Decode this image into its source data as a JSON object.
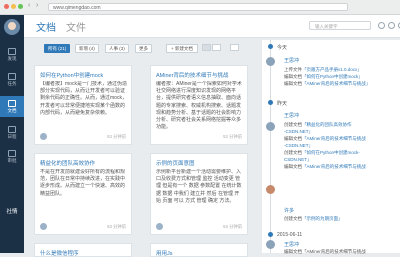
{
  "browser": {
    "url": "www.qimengdao.com"
  },
  "sidebar": {
    "items": [
      {
        "label": "发现",
        "active": false
      },
      {
        "label": "任务",
        "active": false
      },
      {
        "label": "文档",
        "active": true
      },
      {
        "label": "日程",
        "active": false
      },
      {
        "label": "审批",
        "active": false
      }
    ],
    "bottom_label": "社情"
  },
  "header": {
    "tab_docs": "文档",
    "tab_files": "文件",
    "search_placeholder": "输入关键字"
  },
  "filters": {
    "items": [
      "所有 (21)",
      "新增 (4)",
      "人事 (3)",
      "更多"
    ],
    "new_doc": "+ 新建文档"
  },
  "cards": [
    {
      "title": "如何在Python中创建mock",
      "body": "【编者按】mock是一门技术，通过伪造部分实现代码，从而让开发者可以验证剩余代码的正确性。从而，通过mock，开发者可以非常便捷地实现某个函数的内部代码，从而避免复杂依赖。",
      "foot": "53 分钟前"
    },
    {
      "title": "AMiner背后的技术细节与挑战",
      "body": "编者按：AMiner是一个探索如何对学术社交网络进行深度知识发现的网络平台，提供研究者语义信息抽取、面向话题的专家搜索、权威机构搜索、话题发现和趋势分析、基于话题的社会影响力分析、研究者社会关系网络挖掘等众多功能。",
      "foot": "53 分钟前"
    },
    {
      "title": "精益化的团队高效协作",
      "body": "不是在开发前就建设好所有的流程和规范，团队在日常中持续改进，在实践中逐步形成。从而建立一个快速、高效的精益团队。",
      "foot": "53 分钟前"
    },
    {
      "title": "示例的页面意图",
      "body": "示例新平台新建一个活动需要维护、入口及收费方式和管理 监控 活动变更 管理 但是有一个 数据 参数配置 在统计数据 数据 中我们 建立并 然后 在管理 开始 页面 可以 方式 管理 确定 方法。",
      "foot": "53 分钟前"
    },
    {
      "title": "什么是微信程序",
      "body": "",
      "foot": ""
    },
    {
      "title": "用用Js",
      "body": "",
      "foot": ""
    }
  ],
  "activity": {
    "today_label": "今天",
    "groups": [
      {
        "name": "王思冲",
        "lines": [
          {
            "verb": "上传文件",
            "link": "「页雁方产品手册v1.0.docx」"
          },
          {
            "verb": "编辑文档",
            "link": "「如何在Python中创建mock」"
          },
          {
            "verb": "编辑文档",
            "link": "「AMiner背后的技术细节与挑战」"
          }
        ]
      },
      {
        "name": "王思冲",
        "sub": "昨天",
        "lines": [
          {
            "verb": "创建文档",
            "link": "「精益化的团队高效协作"
          },
          {
            "verb": "",
            "link": "-CSDN.NET」"
          },
          {
            "verb": "编辑文档",
            "link": "「AMiner背后的技术细节与挑战"
          },
          {
            "verb": "",
            "link": "-CSDN.NET」"
          },
          {
            "verb": "创建文档",
            "link": "「如何在Python中创建mock-"
          },
          {
            "verb": "",
            "link": "CSDN.NET」"
          },
          {
            "verb": "编辑文档",
            "link": "「AMiner背后的技术细节与挑战"
          }
        ]
      },
      {
        "name": "许多",
        "lines": [
          {
            "verb": "创建文档",
            "link": "「示例的为期页面」"
          }
        ]
      }
    ],
    "date_label": "2015-06-11",
    "last_name": "王思冲",
    "last_line": "编辑文档「AMiner背后的技术细节与挑战"
  }
}
